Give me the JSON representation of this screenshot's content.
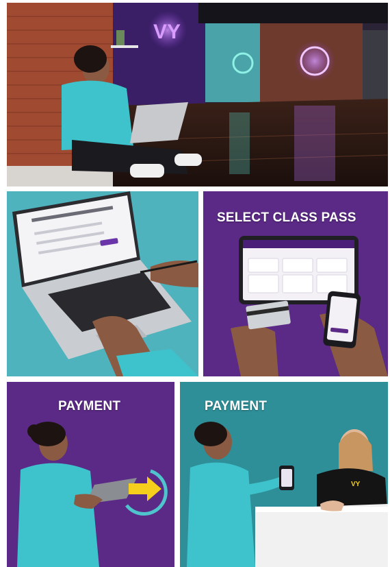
{
  "panels": [
    {
      "id": "studio-laptop"
    },
    {
      "id": "laptop-booking"
    },
    {
      "id": "select-class-pass",
      "caption": "SELECT CLASS PASS"
    },
    {
      "id": "payment-tablet",
      "caption": "PAYMENT"
    },
    {
      "id": "payment-front-desk",
      "caption": "PAYMENT"
    }
  ],
  "colors": {
    "brand_purple": "#5b2a86",
    "neon_purple": "#b45cf0",
    "teal": "#4fb3bd",
    "hoodie_teal": "#3ec3cc",
    "accent_yellow": "#f5cf1c",
    "brick": "#a14a32"
  },
  "icons": [
    "neon-logo-icon",
    "arrow-right-icon",
    "credit-card-icon",
    "smartphone-icon",
    "tablet-icon"
  ]
}
